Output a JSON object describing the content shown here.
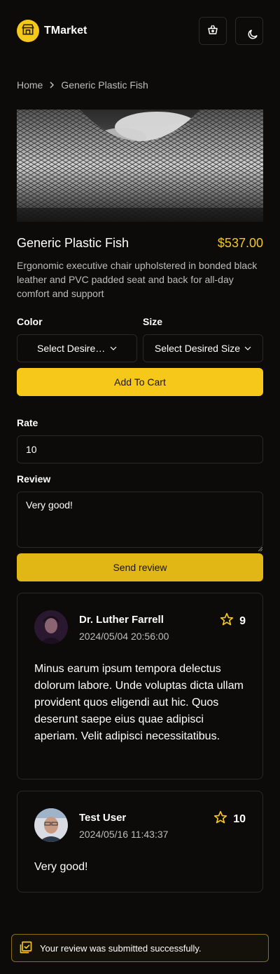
{
  "header": {
    "brand": "TMarket",
    "icons": {
      "logo": "shop-icon",
      "cart": "basket-icon",
      "theme": "moon-icon"
    }
  },
  "breadcrumb": {
    "home": "Home",
    "current": "Generic Plastic Fish"
  },
  "product": {
    "name": "Generic Plastic Fish",
    "price": "$537.00",
    "description": "Ergonomic executive chair upholstered in bonded black leather and PVC padded seat and back for all-day comfort and support"
  },
  "options": {
    "color_label": "Color",
    "color_value": "Select Desired Color",
    "size_label": "Size",
    "size_value": "Select Desired Size",
    "add_to_cart": "Add To Cart"
  },
  "review_form": {
    "rate_label": "Rate",
    "rate_value": "10",
    "review_label": "Review",
    "review_value": "Very good!",
    "send_label": "Send review"
  },
  "reviews": [
    {
      "name": "Dr. Luther Farrell",
      "date": "2024/05/04 20:56:00",
      "rating": "9",
      "body": "Minus earum ipsum tempora delectus dolorum labore. Unde voluptas dicta ullam provident quos eligendi aut hic. Quos deserunt saepe eius quae adipisci aperiam. Velit adipisci necessitatibus."
    },
    {
      "name": "Test User",
      "date": "2024/05/16 11:43:37",
      "rating": "10",
      "body": "Very good!"
    }
  ],
  "toast": {
    "message": "Your review was submitted successfully."
  },
  "colors": {
    "accent": "#f6c81a",
    "background": "#0c0b0a",
    "border": "#2a2825"
  }
}
